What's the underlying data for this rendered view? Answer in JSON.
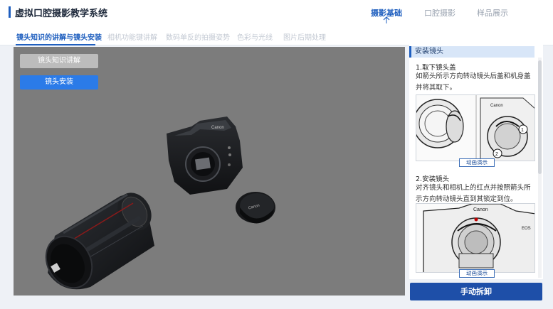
{
  "header": {
    "title": "虚拟口腔摄影教学系统",
    "nav": [
      {
        "label": "摄影基础",
        "active": true
      },
      {
        "label": "口腔摄影",
        "active": false
      },
      {
        "label": "样品展示",
        "active": false
      }
    ]
  },
  "subtabs": [
    {
      "label": "镜头知识的讲解与镜头安装",
      "active": true
    },
    {
      "label": "相机功能键讲解",
      "active": false
    },
    {
      "label": "数码单反的拍摄姿势",
      "active": false
    },
    {
      "label": "色彩与光线",
      "active": false
    },
    {
      "label": "图片后期处理",
      "active": false
    }
  ],
  "viewport": {
    "buttons": [
      {
        "label": "镜头知识讲解",
        "style": "grey"
      },
      {
        "label": "镜头安装",
        "style": "blue"
      }
    ],
    "camera_brand": "Canon"
  },
  "panel": {
    "title": "安装镜头",
    "steps": [
      {
        "title": "1.取下镜头盖",
        "desc": "如箭头所示方向转动镜头后盖和机身盖并将其取下。",
        "button": "动画演示"
      },
      {
        "title": "2.安装镜头",
        "desc": "对齐镜头和相机上的红点并按照箭头所示方向转动镜头直到其锁定到位。",
        "button": "动画演示"
      }
    ]
  },
  "main_button": "手动拆卸",
  "colors": {
    "accent": "#1f5fbf",
    "primary_button": "#1e4fa8",
    "viewport_bg": "#7c7c7c",
    "blue_button": "#2b7be8"
  }
}
